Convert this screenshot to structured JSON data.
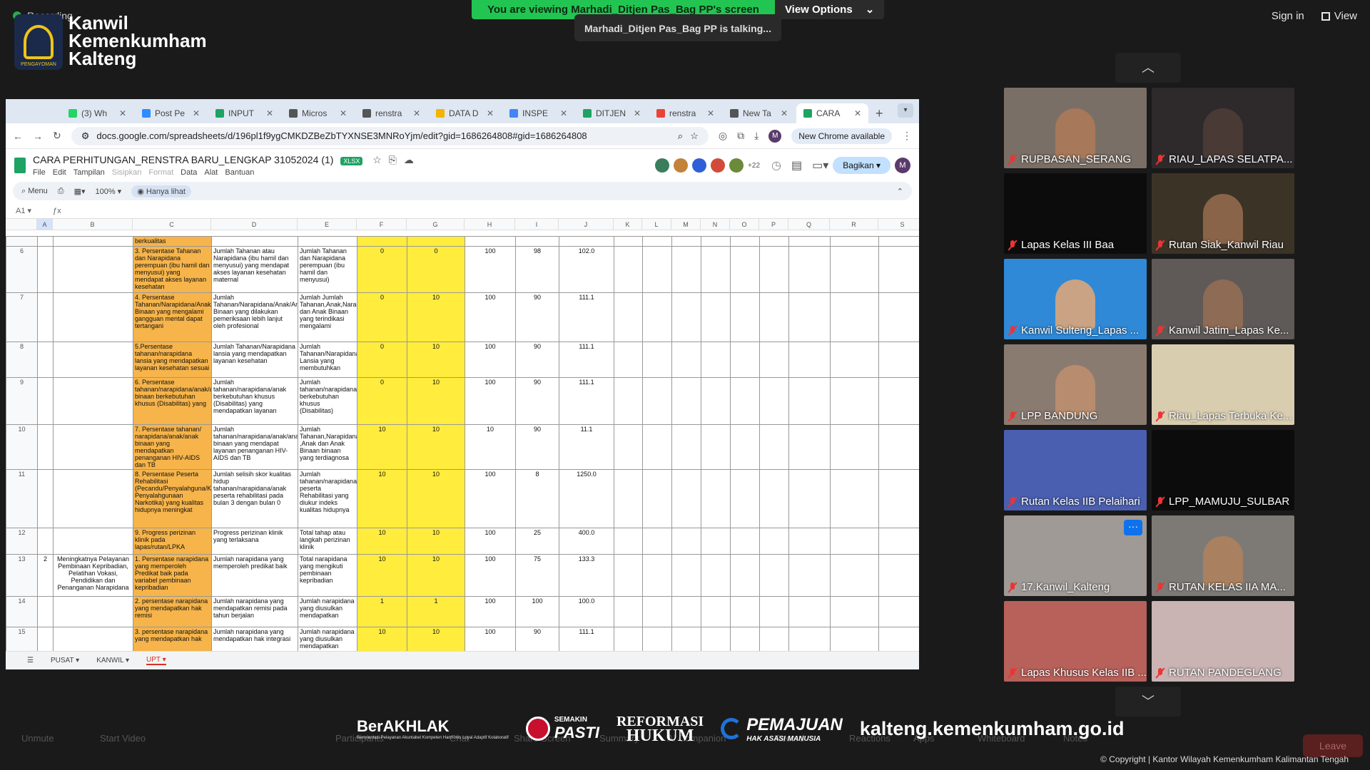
{
  "zoom": {
    "recording_label": "Recording",
    "share_banner": "You are viewing Marhadi_Ditjen Pas_Bag PP's screen",
    "view_options": "View Options",
    "talking": "Marhadi_Ditjen Pas_Bag PP is talking...",
    "sign_in": "Sign in",
    "view": "View",
    "leave": "Leave"
  },
  "logo": {
    "line1": "Kanwil",
    "line2": "Kemenkumham",
    "line3": "Kalteng",
    "emblem_text": "PENGAYOMAN"
  },
  "browser": {
    "tabs": [
      {
        "label": "(3) Wh",
        "color": "#25d366"
      },
      {
        "label": "Post Pe",
        "color": "#2d8cff"
      },
      {
        "label": "INPUT",
        "color": "#1ea362"
      },
      {
        "label": "Micros",
        "color": "#555555"
      },
      {
        "label": "renstra",
        "color": "#555555"
      },
      {
        "label": "DATA D",
        "color": "#f4b400"
      },
      {
        "label": "INSPE",
        "color": "#4285f4"
      },
      {
        "label": "DITJEN",
        "color": "#1ea362"
      },
      {
        "label": "renstra",
        "color": "#ea4335"
      },
      {
        "label": "New Ta",
        "color": "#555555"
      },
      {
        "label": "CARA",
        "color": "#1ea362"
      }
    ],
    "url": "docs.google.com/spreadsheets/d/196pl1f9ygCMKDZBeZbTYXNSE3MNRoYjm/edit?gid=1686264808#gid=1686264808",
    "new_chrome": "New Chrome available"
  },
  "sheet": {
    "title": "CARA PERHITUNGAN_RENSTRA BARU_LENGKAP 31052024 (1)",
    "badge": "XLSX",
    "menu": [
      "File",
      "Edit",
      "Tampilan",
      "Sisipkan",
      "Format",
      "Data",
      "Alat",
      "Bantuan"
    ],
    "collab_count": "+22",
    "share": "Bagikan",
    "user_initial": "M",
    "toolbar_menu": "Menu",
    "zoom": "100%",
    "view_only": "Hanya lihat",
    "cell_ref": "A1",
    "columns": [
      "A",
      "B",
      "C",
      "D",
      "E",
      "F",
      "G",
      "H",
      "I",
      "J",
      "K",
      "L",
      "M",
      "N",
      "O",
      "P",
      "Q",
      "R",
      "S"
    ],
    "tabs": [
      "PUSAT",
      "KANWIL",
      "UPT"
    ],
    "top_fragment": "berkualitas",
    "rows": [
      {
        "n": "6",
        "a": "",
        "b": "",
        "c": "3. Persentase Tahanan dan Narapidana perempuan (ibu hamil dan menyusui) yang mendapat akses layanan kesehatan",
        "d": "Jumlah Tahanan atau Narapidana (ibu hamil dan menyusui) yang mendapat akses layanan kesehatan maternal",
        "e": "Jumlah Tahanan dan Narapidana perempuan (ibu hamil dan menyusui)",
        "f": "0",
        "g": "0",
        "h": "100",
        "i": "98",
        "j": "102.0"
      },
      {
        "n": "7",
        "a": "",
        "b": "",
        "c": "4. Persentase Tahanan/Narapidana/Anak/Anak Binaan yang mengalami gangguan mental dapat tertangani",
        "d": "Jumlah Tahanan/Narapidana/Anak/Anak Binaan yang dilakukan pemeriksaan lebih lanjut oleh profesional",
        "e": "Jumlah Jumlah Tahanan,Anak,Narapidana dan Anak Binaan yang terindikasi mengalami",
        "f": "0",
        "g": "10",
        "h": "100",
        "i": "90",
        "j": "111.1"
      },
      {
        "n": "8",
        "a": "",
        "b": "",
        "c": "5.Persentase tahanan/narapidana lansia yang mendapatkan layanan kesehatan sesuai",
        "d": "Jumlah Tahanan/Narapidana lansia yang mendapatkan layanan kesehatan",
        "e": "Jumlah Tahanan/Narapidana Lansia yang membutuhkan",
        "f": "0",
        "g": "10",
        "h": "100",
        "i": "90",
        "j": "111.1"
      },
      {
        "n": "9",
        "a": "",
        "b": "",
        "c": "6. Persentase tahanan/narapidana/anak/anak binaan berkebutuhan khusus (Disabilitas) yang",
        "d": "Jumlah tahanan/narapidana/anak berkebutuhan khusus (Disabilitas) yang mendapatkan layanan",
        "e": "Jumlah tahanan/narapidana/anak berkebutuhan khusus (Disabilitas)",
        "f": "0",
        "g": "10",
        "h": "100",
        "i": "90",
        "j": "111.1"
      },
      {
        "n": "10",
        "a": "",
        "b": "",
        "c": "7. Persentase tahanan/ narapidana/anak/anak binaan yang mendapatkan penanganan HIV-AIDS dan TB",
        "d": "Jumlah tahanan/narapidana/anak/anak binaan yang mendapat layanan penanganan HIV-AIDS dan TB",
        "e": "Jumlah Tahanan,Narapidana ,Anak dan Anak Binaan binaan yang terdiagnosa",
        "f": "10",
        "g": "10",
        "h": "10",
        "i": "90",
        "j": "11.1"
      },
      {
        "n": "11",
        "a": "",
        "b": "",
        "c": "8. Persentase Peserta Rehabilitasi (Pecandu/Penyalahguna/Korban Penyalahgunaan Narkotika) yang kualitas hidupnya meningkat",
        "d": "Jumlah selisih skor kualitas hidup tahanan/narapidana/anak peserta rehabilitasi pada bulan 3 dengan bulan 0",
        "e": "Jumlah tahanan/narapidana/anak peserta Rehabilitasi yang diukur indeks kualitas hidupnya",
        "f": "10",
        "g": "10",
        "h": "100",
        "i": "8",
        "j": "1250.0"
      },
      {
        "n": "12",
        "a": "",
        "b": "",
        "c": "9. Progress perizinan klinik pada lapas/rutan/LPKA",
        "d": "Progress perizinan klinik yang terlaksana",
        "e": "Total tahap atau langkah perizinan klinik",
        "f": "10",
        "g": "10",
        "h": "100",
        "i": "25",
        "j": "400.0"
      },
      {
        "n": "13",
        "a": "2",
        "b": "Meningkatnya Pelayanan Pembinaan Kepribadian, Pelatihan Vokasi, Pendidikan dan Penanganan Narapidana",
        "c": "1. Persentase narapidana yang memperoleh Predikat baik pada variabel pembinaan kepribadian",
        "d": "Jumlah narapidana yang memperoleh predikat baik",
        "e": "Total narapidana yang mengikuti pembinaan kepribadian",
        "f": "10",
        "g": "10",
        "h": "100",
        "i": "75",
        "j": "133.3"
      },
      {
        "n": "14",
        "a": "",
        "b": "",
        "c": "2. persentase narapidana yang mendapatkan hak remisi",
        "d": "Jumlah narapidana yang mendapatkan remisi pada tahun berjalan",
        "e": "Jumlah narapidana yang diusulkan mendapatkan",
        "f": "1",
        "g": "1",
        "h": "100",
        "i": "100",
        "j": "100.0"
      },
      {
        "n": "15",
        "a": "",
        "b": "",
        "c": "3. persentase narapidana yang mendapatkan hak",
        "d": "Jumlah narapidana yang mendapatkan hak integrasi",
        "e": "Jumlah narapidana yang diusulkan mendapatkan",
        "f": "10",
        "g": "10",
        "h": "100",
        "i": "90",
        "j": "111.1"
      }
    ]
  },
  "participants": [
    {
      "name": "RUPBASAN_SERANG",
      "bg": "#7a6f66",
      "skin": "#a7785a"
    },
    {
      "name": "RIAU_LAPAS SELATPA...",
      "bg": "#2e2a2c",
      "skin": "#4a3a36"
    },
    {
      "name": "Lapas Kelas III Baa",
      "bg": "#0c0c0c",
      "skin": ""
    },
    {
      "name": "Rutan Siak_Kanwil Riau",
      "bg": "#3c3327",
      "skin": "#8a6448"
    },
    {
      "name": "Kanwil Sulteng_Lapas ...",
      "bg": "#2f89d6",
      "skin": "#c9a383"
    },
    {
      "name": "Kanwil Jatim_Lapas Ke...",
      "bg": "#5f5a57",
      "skin": "#8e6b55"
    },
    {
      "name": "LPP BANDUNG",
      "bg": "#8a7b70",
      "skin": "#b88c6e"
    },
    {
      "name": "Riau_Lapas Terbuka Ke...",
      "bg": "#d9cdb0",
      "skin": ""
    },
    {
      "name": "Rutan Kelas IIB Pelaihari",
      "bg": "#4a5fb0",
      "skin": ""
    },
    {
      "name": "LPP_MAMUJU_SULBAR",
      "bg": "#0c0c0c",
      "skin": ""
    },
    {
      "name": "17.Kanwil_Kalteng",
      "bg": "#9f9a96",
      "skin": ""
    },
    {
      "name": "RUTAN KELAS IIA MA...",
      "bg": "#7d7a76",
      "skin": "#a98060"
    },
    {
      "name": "Lapas Khusus Kelas IIB ...",
      "bg": "#b8605a",
      "skin": ""
    },
    {
      "name": "RUTAN PANDEGLANG",
      "bg": "#c9b3b3",
      "skin": ""
    }
  ],
  "footer": {
    "brand1": "BerAKHLAK",
    "brand1_sub": "Berorientasi Pelayanan Akuntabel Kompeten Harmonis Loyal Adaptif Kolaboratif",
    "brand2_top": "SEMAKIN",
    "brand2": "PASTI",
    "brand3_a": "REFORMASI",
    "brand3_b": "HUKUM",
    "brand4": "PEMAJUAN",
    "brand4_sub": "HAK ASASI MANUSIA",
    "website": "kalteng.kemenkumham.go.id",
    "copyright": "© Copyright | Kantor Wilayah Kemenkumham Kalimantan Tengah",
    "controls": [
      "Unmute",
      "Start Video",
      "Participants",
      "Chat",
      "Share Screen",
      "Summary",
      "AI Companion",
      "Record",
      "Reactions",
      "Apps",
      "Whiteboard",
      "Notes"
    ]
  }
}
